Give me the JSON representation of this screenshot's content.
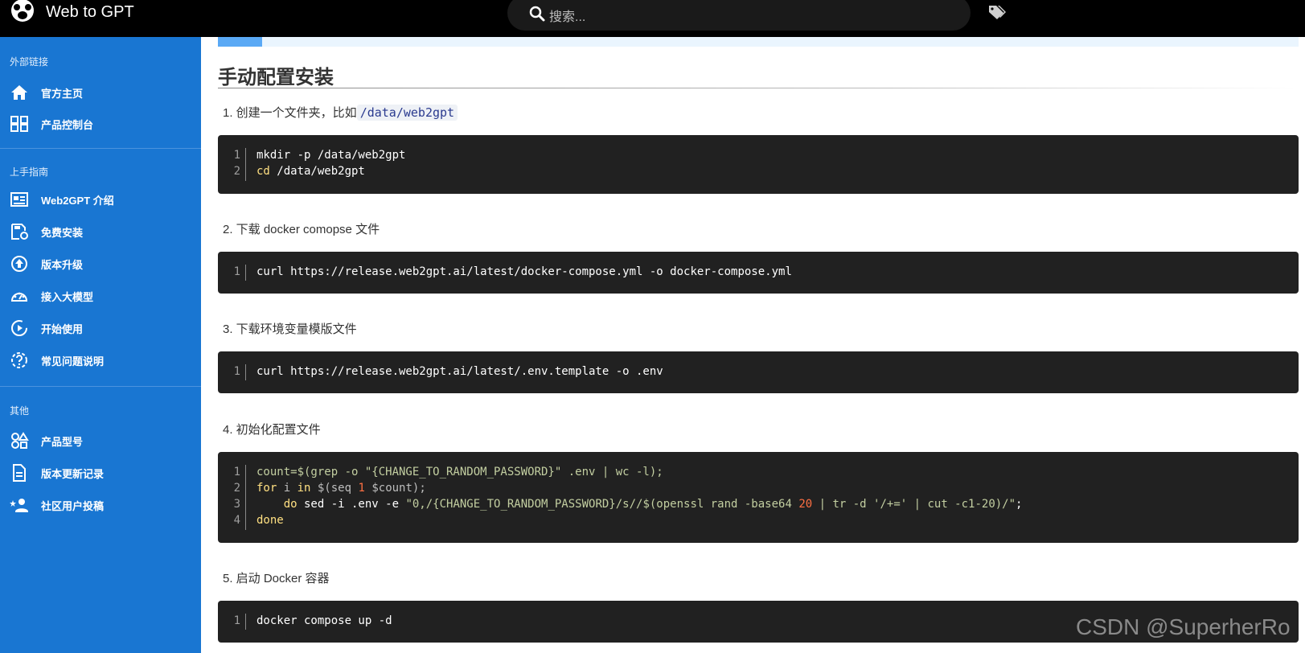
{
  "header": {
    "brand": "Web to GPT",
    "search_placeholder": "搜索..."
  },
  "sidebar": {
    "sections": [
      {
        "title": "外部链接",
        "items": [
          {
            "label": "官方主页",
            "icon": "home-icon"
          },
          {
            "label": "产品控制台",
            "icon": "dashboard-icon"
          }
        ]
      },
      {
        "title": "上手指南",
        "items": [
          {
            "label": "Web2GPT 介绍",
            "icon": "newspaper-icon"
          },
          {
            "label": "免费安装",
            "icon": "install-icon"
          },
          {
            "label": "版本升级",
            "icon": "upgrade-icon"
          },
          {
            "label": "接入大模型",
            "icon": "speedometer-icon"
          },
          {
            "label": "开始使用",
            "icon": "play-circle-icon"
          },
          {
            "label": "常见问题说明",
            "icon": "help-circle-icon"
          }
        ]
      },
      {
        "title": "其他",
        "items": [
          {
            "label": "产品型号",
            "icon": "shapes-icon"
          },
          {
            "label": "版本更新记录",
            "icon": "document-icon"
          },
          {
            "label": "社区用户投稿",
            "icon": "account-star-icon"
          }
        ]
      }
    ]
  },
  "main": {
    "heading": "手动配置安装",
    "steps": [
      {
        "text": "1. 创建一个文件夹，比如",
        "code": "/data/web2gpt"
      },
      {
        "text": "2. 下载 docker comopse 文件"
      },
      {
        "text": "3. 下载环境变量模版文件"
      },
      {
        "text": "4. 初始化配置文件"
      },
      {
        "text": "5. 启动 Docker 容器"
      }
    ],
    "code_blocks": {
      "b1": {
        "n1": "1",
        "n2": "2",
        "l1": "mkdir -p /data/web2gpt",
        "l2_kw": "cd",
        "l2_rest": " /data/web2gpt"
      },
      "b2": {
        "n1": "1",
        "l1": "curl https://release.web2gpt.ai/latest/docker-compose.yml -o docker-compose.yml"
      },
      "b3": {
        "n1": "1",
        "l1": "curl https://release.web2gpt.ai/latest/.env.template -o .env"
      },
      "b4": {
        "n1": "1",
        "n2": "2",
        "n3": "3",
        "n4": "4",
        "l1": "count=$(grep -o \"{CHANGE_TO_RANDOM_PASSWORD}\" .env | wc -l);",
        "l2_kw1": "for",
        "l2_a": " i ",
        "l2_kw2": "in",
        "l2_b": " $(seq ",
        "l2_num": "1",
        "l2_c": " $count);",
        "l3_indent": "    ",
        "l3_kw": "do",
        "l3_a": " sed -i .env -e ",
        "l3_str": "\"0,/{CHANGE_TO_RANDOM_PASSWORD}/s//$(openssl rand -base64 ",
        "l3_num": "20",
        "l3_str2": " | tr -d '/+=' | cut -c1-20)/\"",
        "l3_end": ";",
        "l4_kw": "done"
      },
      "b5": {
        "n1": "1",
        "l1": "docker compose up -d"
      }
    }
  },
  "watermark": "CSDN @SuperherRo",
  "colors": {
    "topbar": "#000000",
    "sidebar": "#1976d2",
    "code_bg": "#212121",
    "keyword": "#ffe082",
    "string": "#c3cfa1",
    "number": "#ff7043"
  }
}
